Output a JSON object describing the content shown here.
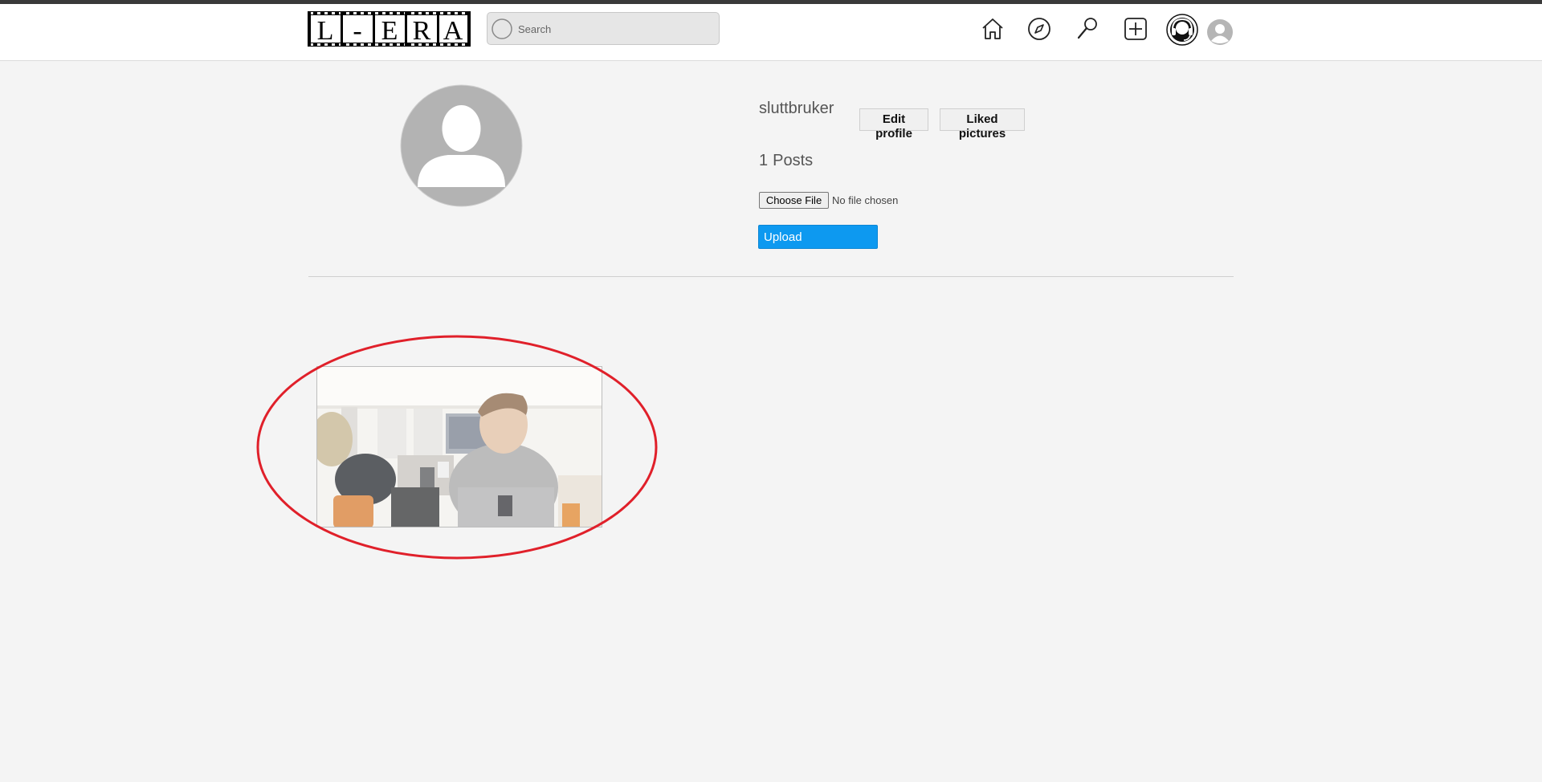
{
  "header": {
    "logo": {
      "letters": [
        "L",
        "-",
        "E",
        "R",
        "A"
      ],
      "icon": "film-strip-logo"
    },
    "search": {
      "placeholder": "Search",
      "value": "",
      "icon": "search-icon"
    },
    "nav": [
      {
        "name": "home",
        "icon": "home-icon"
      },
      {
        "name": "explore",
        "icon": "compass-icon"
      },
      {
        "name": "search",
        "icon": "magnifier-icon"
      },
      {
        "name": "new-post",
        "icon": "plus-square-icon"
      },
      {
        "name": "support",
        "icon": "headset-icon"
      },
      {
        "name": "profile",
        "icon": "avatar-icon"
      }
    ]
  },
  "profile": {
    "username": "sluttbruker",
    "edit_profile_label": "Edit profile",
    "liked_pictures_label": "Liked pictures",
    "post_count": "1",
    "posts_label": "Posts",
    "choose_file_label": "Choose File",
    "no_file_text": "No file chosen",
    "upload_label": "Upload"
  },
  "posts": [
    {
      "description": "webcam photo of a person in a grey hoodie in a classroom"
    }
  ],
  "colors": {
    "top_strip": "#3a3a3a",
    "page_bg": "#f4f4f4",
    "upload_button": "#0d99f0",
    "annotation": "#e0202a"
  }
}
